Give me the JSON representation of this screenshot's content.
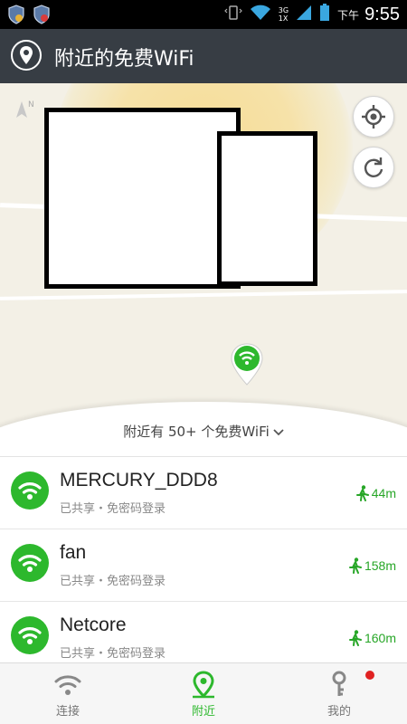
{
  "status_bar": {
    "network_type": "3G",
    "network_sub": "1X",
    "ampm": "下午",
    "time": "9:55"
  },
  "header": {
    "title": "附近的免费WiFi",
    "icon": "location-pin-icon"
  },
  "map": {
    "compass_label": "N",
    "nearby_summary": "附近有 50+ 个免费WiFi"
  },
  "wifi_list": [
    {
      "name": "MERCURY_DDD8",
      "status": "已共享・免密码登录",
      "distance": "44m"
    },
    {
      "name": "fan",
      "status": "已共享・免密码登录",
      "distance": "158m"
    },
    {
      "name": "Netcore",
      "status": "已共享・免密码登录",
      "distance": "160m"
    }
  ],
  "tabs": [
    {
      "label": "连接",
      "icon": "wifi-icon",
      "active": false
    },
    {
      "label": "附近",
      "icon": "location-pin-icon",
      "active": true
    },
    {
      "label": "我的",
      "icon": "key-icon",
      "active": false
    }
  ],
  "colors": {
    "accent_green": "#2db82d",
    "header_bg": "#373d44",
    "badge_red": "#e02222"
  }
}
